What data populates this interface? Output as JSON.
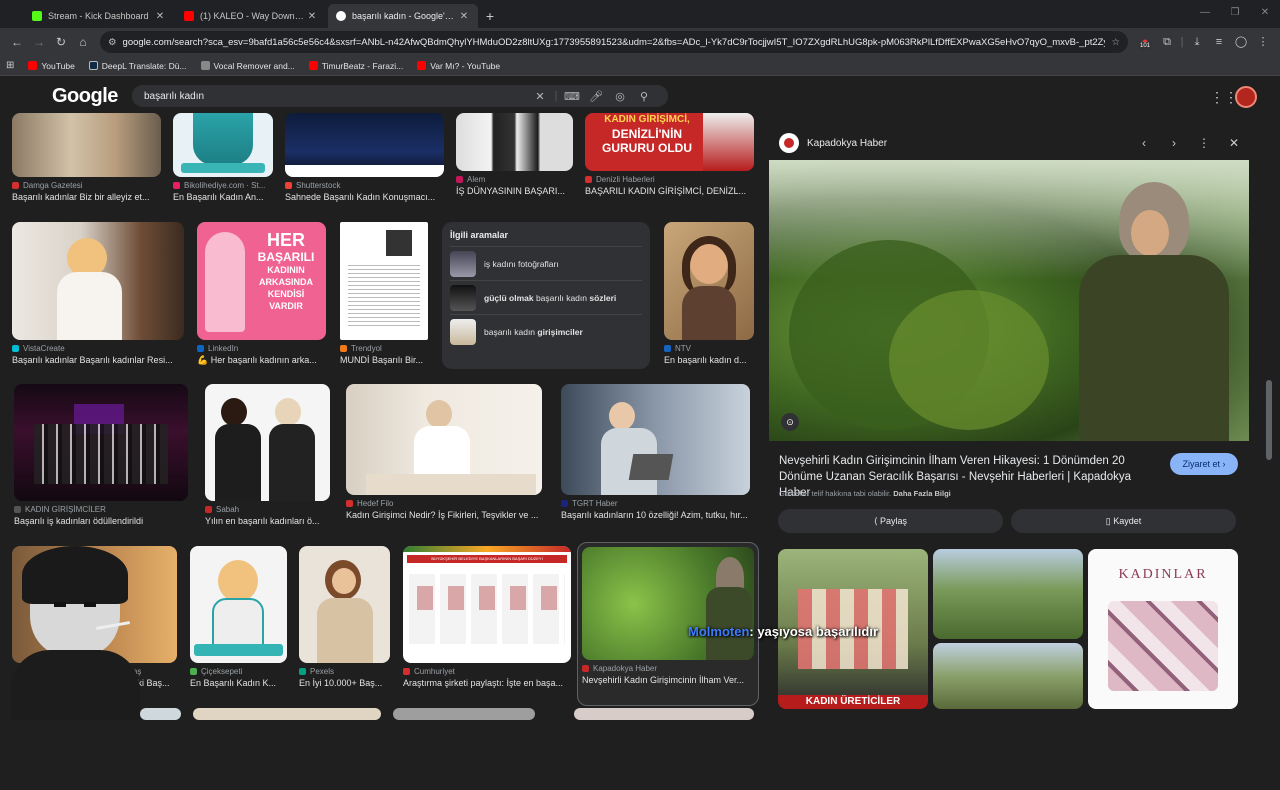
{
  "tabs": [
    {
      "title": "Stream - Kick Dashboard",
      "color": "#53fc18",
      "active": false
    },
    {
      "title": "(1) KALEO - Way Down We Go",
      "color": "#ff0000",
      "active": false
    },
    {
      "title": "başarılı kadın - Google'da Ara",
      "color": "#4285f4",
      "active": true
    }
  ],
  "address": {
    "url": "google.com/search?sca_esv=9bafd1a56c5e56c4&sxsrf=ANbL-n42AfwQBdmQhylYHMduOD2z8ltUXg:1773955891523&udm=2&fbs=ADc_l-Yk7dC9rTocjjwI5T_IO7ZXgdRLhUG8pk-pM063RkPlLfDffEXPwaXG5eHvO7qyO_mxvB-_pt2ZyNJIVa-ipFUKTmBSN5jp..."
  },
  "toolbar": {
    "badge": "101"
  },
  "bookmarks": [
    {
      "label": "YouTube",
      "color": "#ff0000"
    },
    {
      "label": "DeepL Translate: Dü...",
      "color": "#0f2b46"
    },
    {
      "label": "Vocal Remover and...",
      "color": "#888888"
    },
    {
      "label": "TimurBeatz - Farazi...",
      "color": "#ff0000"
    },
    {
      "label": "Var Mı? - YouTube",
      "color": "#ff0000"
    }
  ],
  "google": {
    "logo": "Google",
    "query": "başarılı kadın"
  },
  "results": {
    "row1": [
      {
        "source": "Damga Gazetesi",
        "caption": "Başarılı kadınlar Biz bir alleyiz et...",
        "fav": "#d32f2f"
      },
      {
        "source": "Bikolihediye.com · St...",
        "caption": "En Başarılı Kadın An...",
        "fav": "#e91e63"
      },
      {
        "source": "Shutterstock",
        "caption": "Sahnede Başarılı Kadın Konuşmacı...",
        "fav": "#ee4035"
      },
      {
        "source": "Alem",
        "caption": "İŞ DÜNYASININ BAŞARI...",
        "fav": "#c2185b"
      },
      {
        "source": "Denizli Haberleri",
        "caption": "BAŞARILI KADIN GİRİŞİMCİ, DENİZL...",
        "fav": "#d32f2f"
      }
    ],
    "row1_img_text": {
      "card4": "KADIN GİRİŞİMCİ, DENİZLİ'NİN GURURU OLDU",
      "card4_lines": [
        "KADIN GİRİŞİMCİ,",
        "DENİZLİ'NİN",
        "GURURU OLDU"
      ]
    },
    "row2": [
      {
        "source": "VistaCreate",
        "caption": "Başarılı kadınlar Başarılı kadınlar Resi...",
        "fav": "#00bcd4"
      },
      {
        "source": "LinkedIn",
        "caption": "💪 Her başarılı kadının arka...",
        "fav": "#0a66c2"
      },
      {
        "source": "Trendyol",
        "caption": "MUNDİ Başarılı Bir...",
        "fav": "#f27a1a"
      },
      {
        "source": "NTV",
        "caption": "En başarılı kadın d...",
        "fav": "#1565c0"
      }
    ],
    "poster_text": [
      "HER",
      "BAŞARILI",
      "KADININ",
      "ARKASINDA",
      "KENDİSİ",
      "VARDIR"
    ],
    "related": {
      "title": "İlgili aramalar",
      "items": [
        {
          "pre": "",
          "bold": "",
          "label": "iş kadını fotoğrafları"
        },
        {
          "pre": "güçlü olmak",
          "bold": "",
          "label": " başarılı kadın ",
          "post": "sözleri"
        },
        {
          "pre": "",
          "bold": "",
          "label": "başarılı kadın ",
          "post": "girişimciler"
        }
      ]
    },
    "row3": [
      {
        "source": "KADIN GİRİŞİMCİLER",
        "caption": "Başarılı iş kadınları ödüllendirildi",
        "fav": "#555555"
      },
      {
        "source": "Sabah",
        "caption": "Yılın en başarılı kadınları ö...",
        "fav": "#c62828"
      },
      {
        "source": "Hedef Filo",
        "caption": "Kadın Girişimci Nedir? İş Fikirleri, Teşvikler ve ...",
        "fav": "#d32f2f"
      },
      {
        "source": "TGRT Haber",
        "caption": "Başarılı kadınların 10 özelliği! Azim, tutku, hır...",
        "fav": "#1a237e"
      }
    ],
    "row4": [
      {
        "source": "- Koçtaş",
        "caption": "teki Baş...",
        "fav": "#ff6f00"
      },
      {
        "source": "Çiçeksepeti",
        "caption": "En Başarılı Kadın K...",
        "fav": "#4caf50"
      },
      {
        "source": "Pexels",
        "caption": "En İyi 10.000+ Baş...",
        "fav": "#05a081"
      },
      {
        "source": "Cumhuriyet",
        "caption": "Araştırma şirketi paylaştı: İşte en başa...",
        "fav": "#d32f2f"
      },
      {
        "source": "Kapadokya Haber",
        "caption": "Nevşehirli Kadın Girişimcinin İlham Ver...",
        "fav": "#c62828"
      }
    ],
    "chart_card_title": "BÜYÜKŞEHİR BELEDİYE BAŞKANLARININ BAŞARI DÜZEYİ"
  },
  "panel": {
    "site": "Kapadokya Haber",
    "title": "Nevşehirli Kadın Girişimcinin İlham Veren Hikayesi: 1 Dönümden 20 Dönüme Uzanan Seracılık Başarısı - Nevşehir Haberleri | Kapadokya Haber",
    "visit": "Ziyaret et",
    "credit_prefix": "Görseller telif hakkına tabi olabilir.",
    "credit_link": "Daha Fazla Bilgi",
    "share": "Paylaş",
    "save": "Kaydet",
    "more_img1_text": "KADIN ÜRETİCİLER",
    "more_img3_text": "KADINLAR"
  },
  "overlay": {
    "name": "Molmoten",
    "text": ": yaşıyosa başarılıdır"
  }
}
